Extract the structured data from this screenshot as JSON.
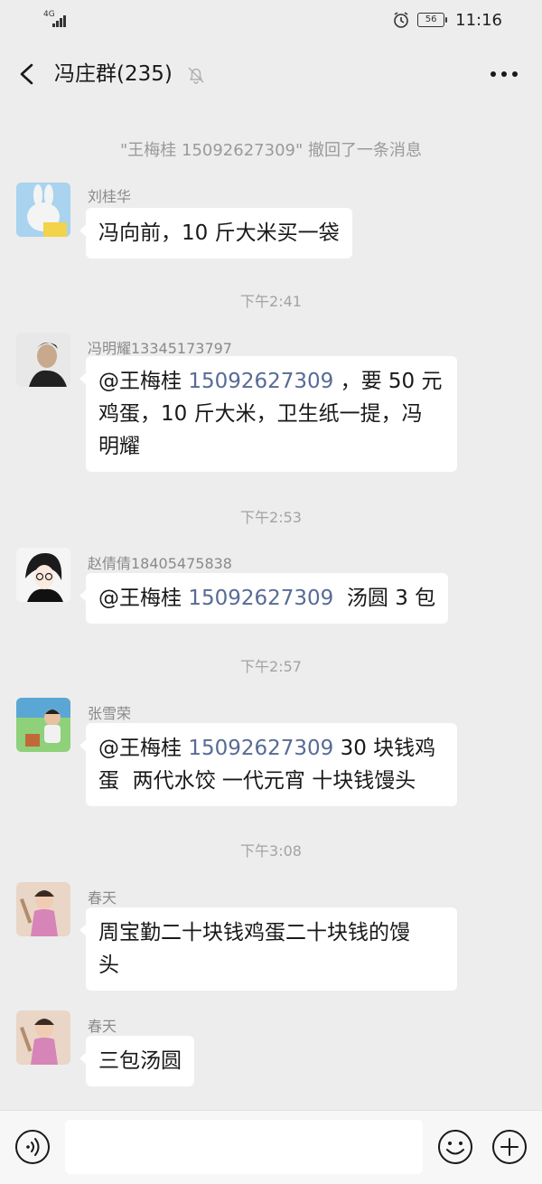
{
  "status_bar": {
    "network": "4G",
    "battery": "56",
    "time": "11:16"
  },
  "header": {
    "title": "冯庄群(235)",
    "icons": {
      "back": "back-chevron-icon",
      "mute": "mute-bell-icon",
      "more": "more-dots-icon"
    }
  },
  "chat": {
    "recall_notice": "\"王梅桂 15092627309\" 撤回了一条消息",
    "timestamps": [
      "下午2:41",
      "下午2:53",
      "下午2:57",
      "下午3:08"
    ],
    "messages": [
      {
        "sender": "刘桂华",
        "text": "冯向前，10 斤大米买一袋",
        "avatar_color": "#9cc7e8"
      },
      {
        "sender": "冯明耀13345173797",
        "mention": "@王梅桂 ",
        "phone": "15092627309",
        "line1_rest": " ，要 50 元",
        "line2": "鸡蛋，10 斤大米，卫生纸一提，冯",
        "line3": "明耀",
        "avatar_color": "#2f2f2f"
      },
      {
        "sender": "赵倩倩18405475838",
        "mention": "@王梅桂 ",
        "phone": "15092627309",
        "rest": "  汤圆 3 包",
        "avatar_color": "#f2f2f2"
      },
      {
        "sender": "张雪荣",
        "mention": "@王梅桂 ",
        "phone": "15092627309",
        "line1_rest": " 30 块钱鸡",
        "line2": "蛋  两代水饺 一代元宵 十块钱馒头",
        "avatar_color": "#6fbf6a"
      },
      {
        "sender": "春天",
        "line1": "周宝勤二十块钱鸡蛋二十块钱的馒",
        "line2": "头",
        "avatar_color": "#d9a8c8"
      },
      {
        "sender": "春天",
        "text": "三包汤圆",
        "avatar_color": "#d9a8c8"
      }
    ]
  },
  "input_bar": {
    "placeholder": "",
    "icons": {
      "voice": "voice-icon",
      "emoji": "emoji-icon",
      "plus": "plus-icon"
    }
  },
  "colors": {
    "background": "#ededed",
    "bubble": "#ffffff",
    "phone_link": "#576b95",
    "meta_text": "#9a9a9a"
  }
}
